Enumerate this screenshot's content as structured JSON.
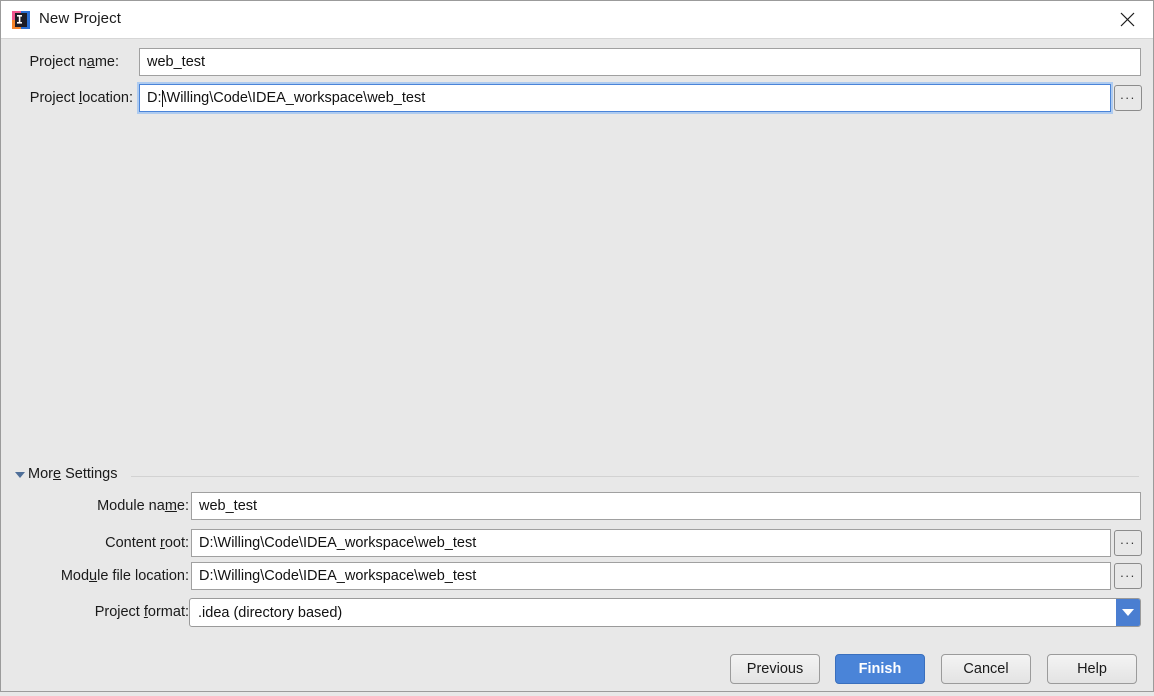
{
  "window": {
    "title": "New Project",
    "icon": "intellij-idea-icon",
    "close_label": "✕"
  },
  "colors": {
    "accent": "#4a84d8",
    "dialog_bg": "#e8e8e8",
    "field_bg": "#ffffff",
    "focus_border": "#4a84d8",
    "combo_arrow_bg": "#4a7ed1",
    "disclosure_arrow": "#4f6f99"
  },
  "top_form": {
    "project_name": {
      "label_pre": "Project n",
      "label_mnemonic": "a",
      "label_post": "me:",
      "value": "web_test"
    },
    "project_location": {
      "label_pre": "Project ",
      "label_mnemonic": "l",
      "label_post": "ocation:",
      "value_before_caret": "D:",
      "value_after_caret": "\\Willing\\Code\\IDEA_workspace\\web_test",
      "value": "D:\\Willing\\Code\\IDEA_workspace\\web_test",
      "browse_label": "..."
    }
  },
  "more_settings": {
    "label_pre": "Mor",
    "label_mnemonic": "e",
    "label_post": " Settings",
    "expanded": true,
    "fields": {
      "module_name": {
        "label_pre": "Module na",
        "label_mnemonic": "m",
        "label_post": "e:",
        "value": "web_test"
      },
      "content_root": {
        "label_pre": "Content ",
        "label_mnemonic": "r",
        "label_post": "oot:",
        "value": "D:\\Willing\\Code\\IDEA_workspace\\web_test",
        "browse_label": "..."
      },
      "module_file_location": {
        "label_pre": "Mod",
        "label_mnemonic": "u",
        "label_post": "le file location:",
        "value": "D:\\Willing\\Code\\IDEA_workspace\\web_test",
        "browse_label": "..."
      },
      "project_format": {
        "label_pre": "Project ",
        "label_mnemonic": "f",
        "label_post": "ormat:",
        "value": ".idea (directory based)",
        "options": [
          ".idea (directory based)"
        ]
      }
    }
  },
  "footer": {
    "previous_label": "Previous",
    "finish_label": "Finish",
    "cancel_label": "Cancel",
    "help_label": "Help"
  }
}
